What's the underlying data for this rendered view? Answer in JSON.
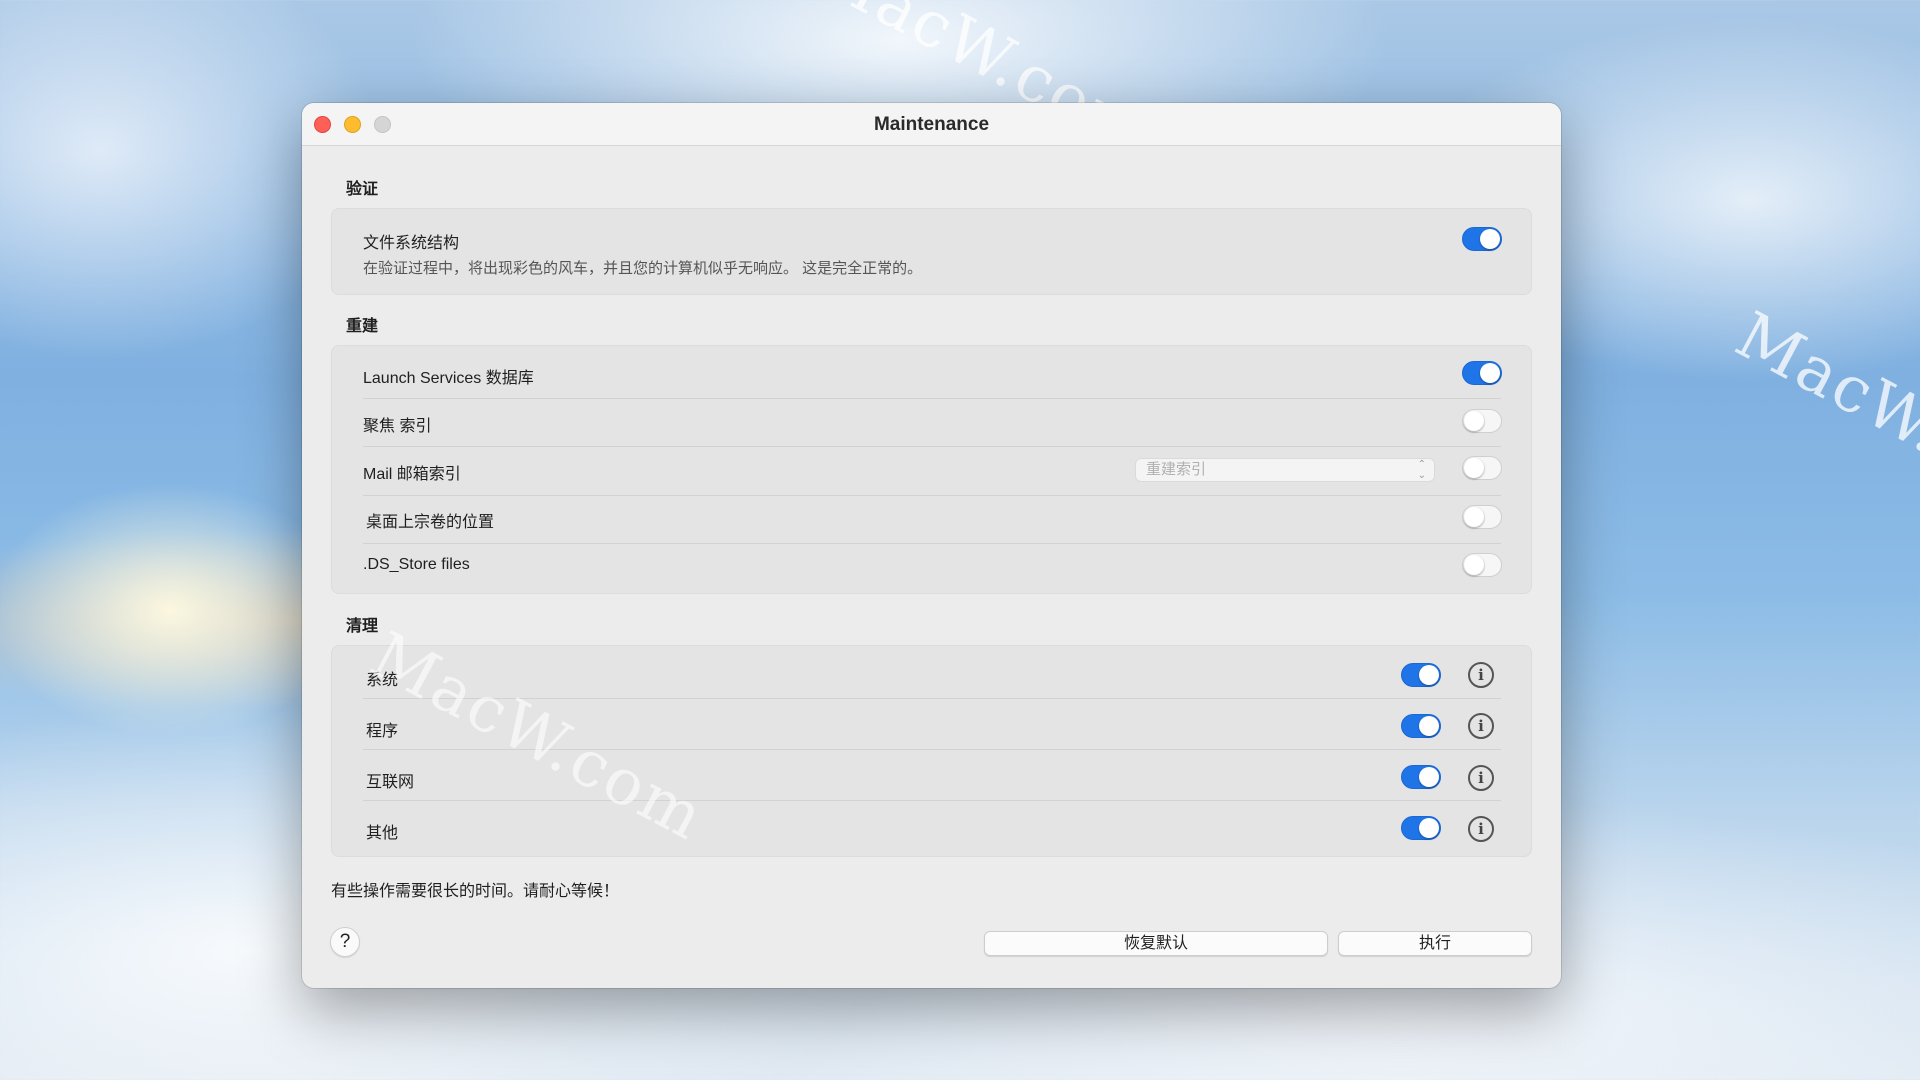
{
  "watermarks": [
    "MacW.com",
    "MacW.com",
    "MacW.com"
  ],
  "window": {
    "title": "Maintenance"
  },
  "sections": {
    "verify": {
      "title": "验证",
      "items": [
        {
          "label": "文件系统结构",
          "description": "在验证过程中，将出现彩色的风车，并且您的计算机似乎无响应。 这是完全正常的。",
          "enabled": true
        }
      ]
    },
    "rebuild": {
      "title": "重建",
      "items": [
        {
          "label": "Launch Services 数据库",
          "enabled": true
        },
        {
          "label": "聚焦 索引",
          "enabled": false
        },
        {
          "label": "Mail 邮箱索引",
          "enabled": false,
          "select_value": "重建索引"
        },
        {
          "label": "桌面上宗卷的位置",
          "enabled": false
        },
        {
          "label": ".DS_Store files",
          "enabled": false
        }
      ]
    },
    "cleanup": {
      "title": "清理",
      "items": [
        {
          "label": "系统",
          "enabled": true
        },
        {
          "label": "程序",
          "enabled": true
        },
        {
          "label": "互联网",
          "enabled": true
        },
        {
          "label": "其他",
          "enabled": true
        }
      ]
    }
  },
  "footer": {
    "note": "有些操作需要很长的时间。请耐心等候！",
    "help_label": "?",
    "restore_defaults_label": "恢复默认",
    "execute_label": "执行"
  },
  "icons": {
    "info": "i",
    "select_chevron": "⌃⌄"
  },
  "colors": {
    "accent": "#1f75e8",
    "close": "#fe5f57",
    "minimize": "#febc2e"
  }
}
